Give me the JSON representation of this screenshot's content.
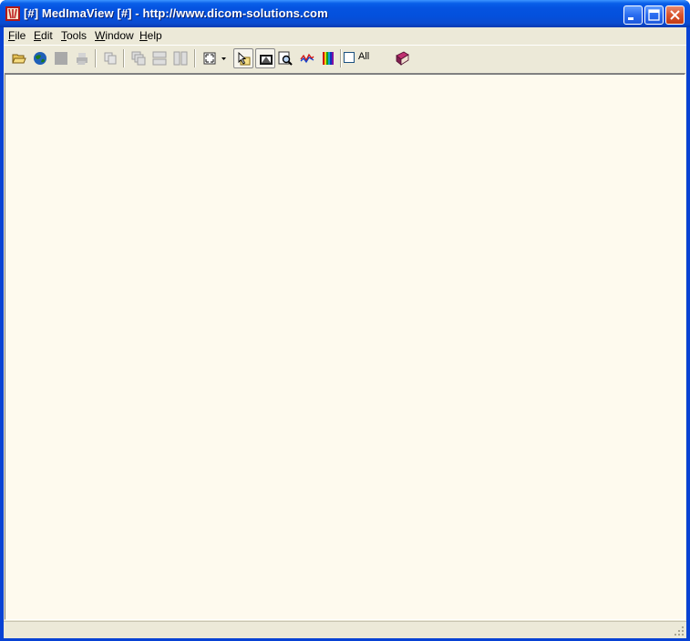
{
  "window": {
    "title": "[#] MedImaView [#] - http://www.dicom-solutions.com",
    "icon": "medimaview-app-icon",
    "controls": [
      "minimize-icon",
      "maximize-icon",
      "close-icon"
    ]
  },
  "menubar": {
    "items": [
      {
        "mnemonic": "F",
        "rest": "ile"
      },
      {
        "mnemonic": "E",
        "rest": "dit"
      },
      {
        "mnemonic": "T",
        "rest": "ools"
      },
      {
        "mnemonic": "W",
        "rest": "indow"
      },
      {
        "mnemonic": "H",
        "rest": "elp"
      }
    ]
  },
  "toolbar": {
    "buttons": [
      "open-folder-icon",
      "globe-icon",
      "save-icon",
      "print-icon",
      "copy-icon",
      "cascade-icon",
      "tile-horizontal-icon",
      "tile-vertical-icon",
      "fit-screen-icon",
      "dropdown-arrow-icon",
      "pointer-select-icon",
      "window-level-icon",
      "zoom-icon",
      "profile-icon",
      "color-palette-icon",
      "help-book-icon"
    ],
    "all_label": "All",
    "all_checked": false
  },
  "colors": {
    "titlebar": "#0553e0",
    "workspace": "#fefaee",
    "chrome": "#ece9d8"
  }
}
